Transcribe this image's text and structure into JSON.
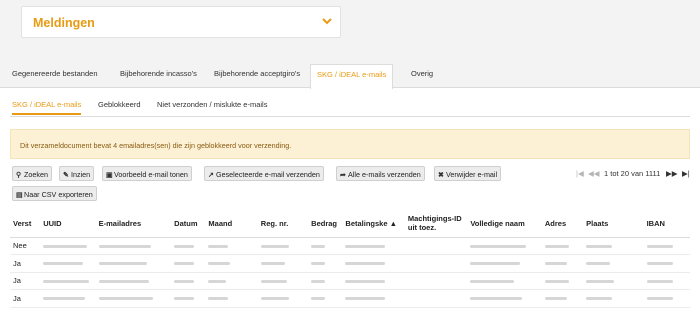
{
  "notifications": {
    "title": "Meldingen",
    "toggle_icon": "chevron-down-icon"
  },
  "tabs": [
    {
      "label": "Gegenereerde bestanden",
      "active": false
    },
    {
      "label": "Bijbehorende incasso's",
      "active": false
    },
    {
      "label": "Bijbehorende acceptgiro's",
      "active": false
    },
    {
      "label": "SKG / iDEAL e-mails",
      "active": true
    },
    {
      "label": "Overig",
      "active": false
    }
  ],
  "subtabs": [
    {
      "label": "SKG / iDEAL e-mails",
      "active": true
    },
    {
      "label": "Geblokkeerd",
      "active": false
    },
    {
      "label": "Niet verzonden / mislukte e-mails",
      "active": false
    }
  ],
  "alert": {
    "text": "Dit verzameldocument bevat 4 emailadres(sen) die zijn geblokkeerd voor verzending."
  },
  "toolbar": {
    "buttons": [
      {
        "label": "Zoeken",
        "icon": "search-icon"
      },
      {
        "label": "Inzien",
        "icon": "edit-icon"
      },
      {
        "label": "Voorbeeld e-mail tonen",
        "icon": "preview-icon"
      },
      {
        "label": "Geselecteerde e-mail verzenden",
        "icon": "share-icon"
      },
      {
        "label": "Alle e-mails verzenden",
        "icon": "forward-icon"
      },
      {
        "label": "Verwijder e-mail",
        "icon": "close-icon"
      },
      {
        "label": "Naar CSV exporteren",
        "icon": "file-icon"
      }
    ]
  },
  "pager": {
    "text": "1 tot 20 van 1111",
    "first": "|◀",
    "prev": "◀◀",
    "next": "▶▶",
    "last": "▶|"
  },
  "table": {
    "columns": [
      "Verst",
      "UUID",
      "E-mailadres",
      "Datum",
      "Maand",
      "Reg. nr.",
      "Bedrag",
      "Betalingske ▲",
      "Machtigings-ID uit toez.",
      "Volledige naam",
      "Adres",
      "Plaats",
      "IBAN"
    ],
    "rows": [
      {
        "verst": "Nee"
      },
      {
        "verst": "Ja"
      },
      {
        "verst": "Ja"
      },
      {
        "verst": "Ja"
      }
    ]
  }
}
